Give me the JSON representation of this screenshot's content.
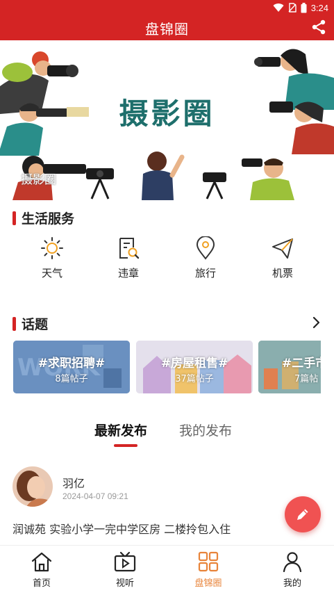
{
  "status_bar": {
    "time": "3:24"
  },
  "header": {
    "title": "盘锦圈"
  },
  "banner": {
    "title": "摄影圈",
    "watermark": "摄影圈"
  },
  "services": {
    "title": "生活服务",
    "items": [
      {
        "label": "天气",
        "icon": "sun-icon"
      },
      {
        "label": "违章",
        "icon": "document-search-icon"
      },
      {
        "label": "旅行",
        "icon": "location-pin-icon"
      },
      {
        "label": "机票",
        "icon": "paper-plane-icon"
      }
    ]
  },
  "topics": {
    "title": "话题",
    "items": [
      {
        "name": "#求职招聘#",
        "count": "8篇帖子"
      },
      {
        "name": "#房屋租售#",
        "count": "37篇帖子"
      },
      {
        "name": "#二手市",
        "count": "7篇帖"
      }
    ]
  },
  "feed": {
    "tabs": [
      {
        "label": "最新发布"
      },
      {
        "label": "我的发布"
      }
    ],
    "post": {
      "username": "羽亿",
      "timestamp": "2024-04-07 09:21",
      "text": "润诚苑 实验小学一完中学区房 二楼拎包入住"
    }
  },
  "bottom_nav": {
    "items": [
      {
        "label": "首页",
        "icon": "home-icon"
      },
      {
        "label": "视听",
        "icon": "tv-play-icon"
      },
      {
        "label": "盘锦圈",
        "icon": "grid-icon"
      },
      {
        "label": "我的",
        "icon": "user-icon"
      }
    ]
  },
  "colors": {
    "brand_red": "#d42424",
    "accent_orange": "#e8843a",
    "fab_red": "#f05252",
    "banner_teal": "#1e6f6c"
  }
}
